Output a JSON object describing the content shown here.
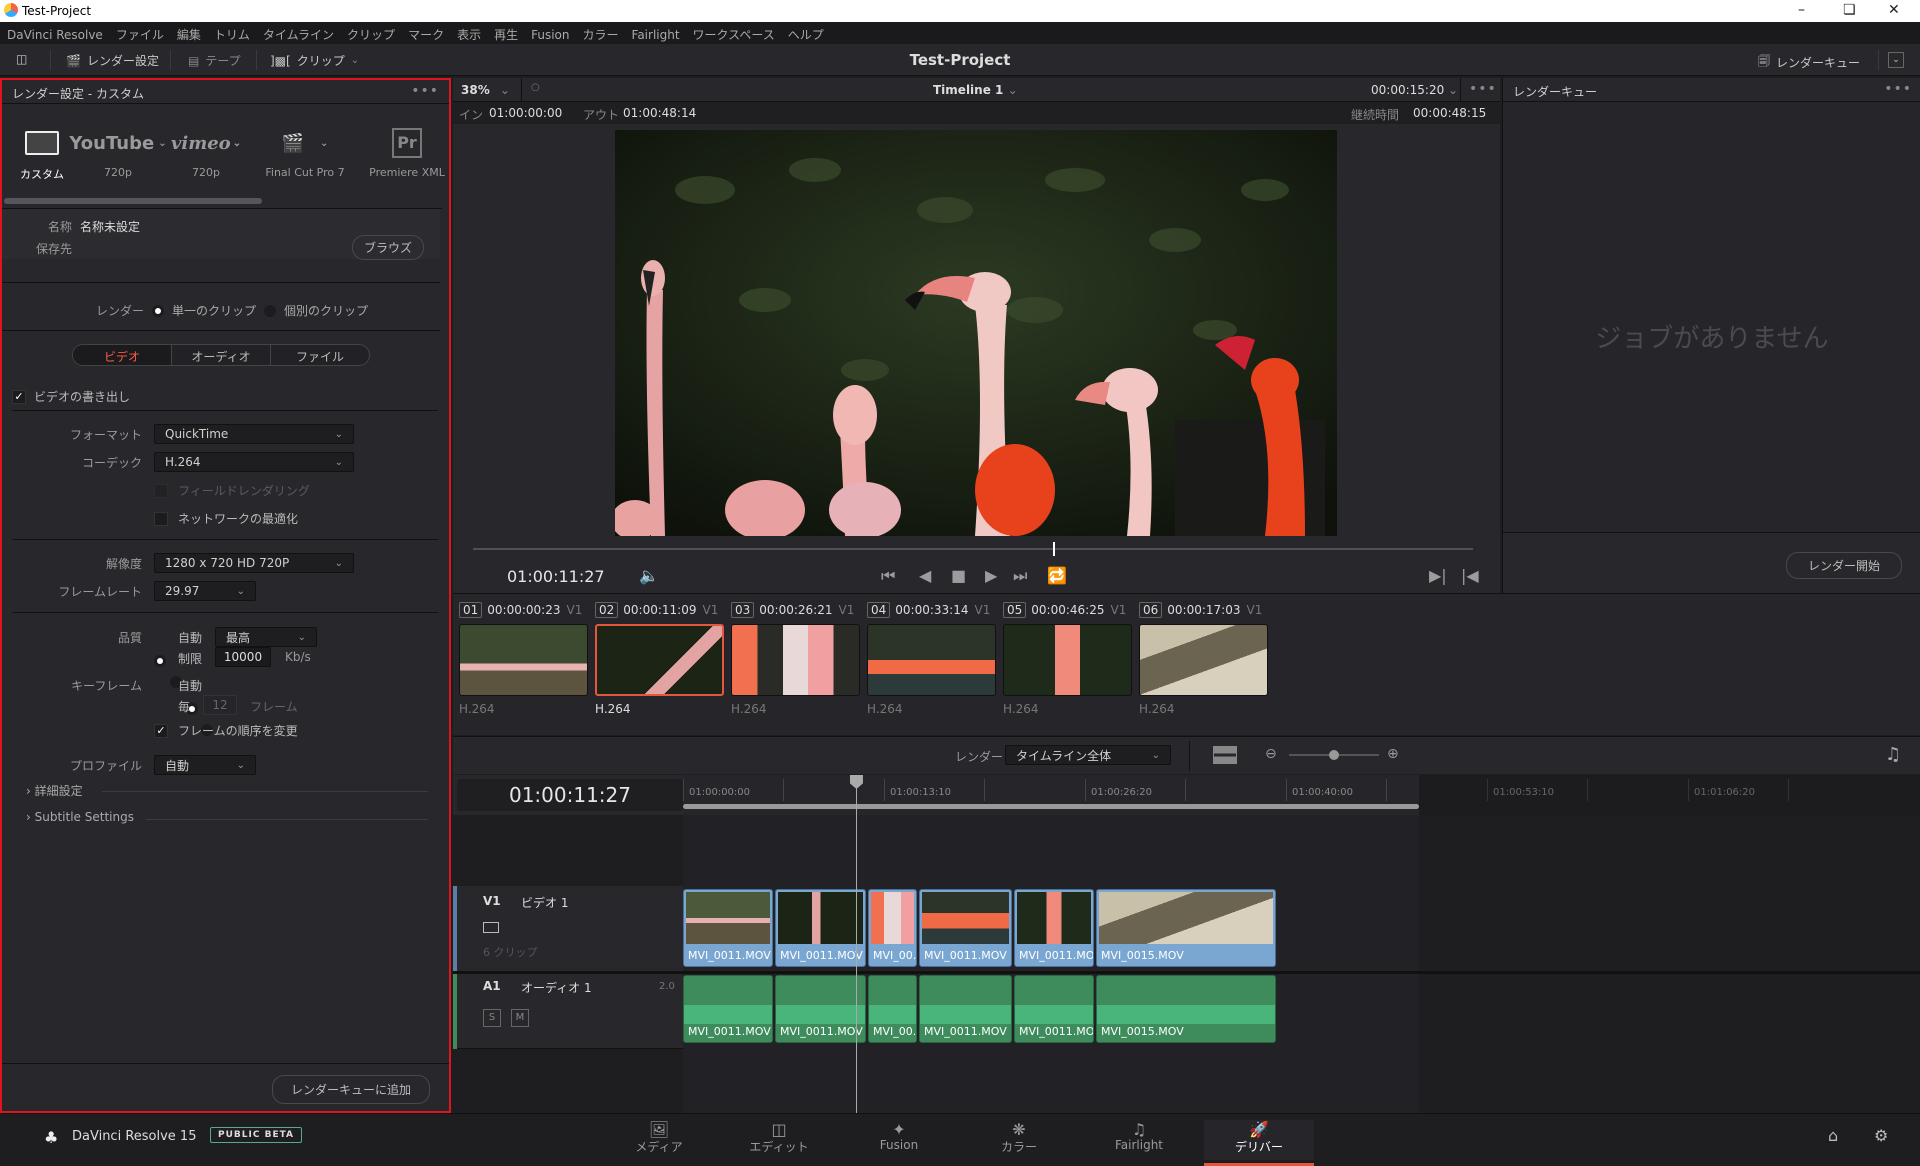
{
  "window": {
    "title": "Test-Project",
    "controls": [
      "minimize",
      "restore",
      "close"
    ]
  },
  "menu": [
    "DaVinci Resolve",
    "ファイル",
    "編集",
    "トリム",
    "タイムライン",
    "クリップ",
    "マーク",
    "表示",
    "再生",
    "Fusion",
    "カラー",
    "Fairlight",
    "ワークスペース",
    "ヘルプ"
  ],
  "toolbar": {
    "render_settings": "レンダー設定",
    "tape": "テープ",
    "clip": "クリップ",
    "project_title": "Test-Project",
    "render_queue": "レンダーキュー"
  },
  "render_settings": {
    "header": "レンダー設定 - カスタム",
    "presets": [
      {
        "icon": "film-icon",
        "label": "カスタム",
        "active": true
      },
      {
        "icon": "youtube-logo",
        "logo": "YouTube",
        "label": "720p"
      },
      {
        "icon": "vimeo-logo",
        "logo": "vimeo",
        "label": "720p"
      },
      {
        "icon": "clapper-icon",
        "label": "Final Cut Pro 7"
      },
      {
        "icon": "premiere-icon",
        "logo": "Pr",
        "label": "Premiere XML"
      }
    ],
    "name_label": "名称",
    "name_value": "名称未設定",
    "location_label": "保存先",
    "browse": "ブラウズ",
    "render_label": "レンダー",
    "render_single": "単一のクリップ",
    "render_individual": "個別のクリップ",
    "render_mode": "single",
    "tabs": [
      "ビデオ",
      "オーディオ",
      "ファイル"
    ],
    "active_tab": "ビデオ",
    "export_video": {
      "label": "ビデオの書き出し",
      "checked": true
    },
    "format_label": "フォーマット",
    "format_value": "QuickTime",
    "codec_label": "コーデック",
    "codec_value": "H.264",
    "field_rendering": {
      "label": "フィールドレンダリング",
      "checked": false,
      "disabled": true
    },
    "network_opt": {
      "label": "ネットワークの最適化",
      "checked": false
    },
    "resolution_label": "解像度",
    "resolution_value": "1280 x 720 HD 720P",
    "framerate_label": "フレームレート",
    "framerate_value": "29.97",
    "quality_label": "品質",
    "quality_auto": "自動",
    "quality_auto_value": "最高",
    "quality_limit": "制限",
    "quality_limit_value": "10000",
    "quality_unit": "Kb/s",
    "keyframe_label": "キーフレーム",
    "keyframe_auto": "自動",
    "keyframe_every": "毎",
    "keyframe_every_value": "12",
    "keyframe_unit": "フレーム",
    "reorder": {
      "label": "フレームの順序を変更",
      "checked": true
    },
    "profile_label": "プロファイル",
    "profile_value": "自動",
    "advanced": "詳細設定",
    "subtitle": "Subtitle Settings",
    "add_to_queue": "レンダーキューに追加"
  },
  "viewer": {
    "zoom": "38%",
    "timeline_name": "Timeline 1",
    "timecode_top": "00:00:15:20",
    "in_label": "イン",
    "in_value": "01:00:00:00",
    "out_label": "アウト",
    "out_value": "01:00:48:14",
    "duration_label": "継続時間",
    "duration_value": "00:00:48:15",
    "current_tc": "01:00:11:27",
    "scrub_position": 0.58
  },
  "queue": {
    "header": "レンダーキュー",
    "empty": "ジョブがありません",
    "start": "レンダー開始"
  },
  "clips": [
    {
      "num": "01",
      "tc": "00:00:00:23",
      "track": "V1",
      "codec": "H.264",
      "selected": false
    },
    {
      "num": "02",
      "tc": "00:00:11:09",
      "track": "V1",
      "codec": "H.264",
      "selected": true
    },
    {
      "num": "03",
      "tc": "00:00:26:21",
      "track": "V1",
      "codec": "H.264",
      "selected": false
    },
    {
      "num": "04",
      "tc": "00:00:33:14",
      "track": "V1",
      "codec": "H.264",
      "selected": false
    },
    {
      "num": "05",
      "tc": "00:00:46:25",
      "track": "V1",
      "codec": "H.264",
      "selected": false
    },
    {
      "num": "06",
      "tc": "00:00:17:03",
      "track": "V1",
      "codec": "H.264",
      "selected": false
    }
  ],
  "timeline": {
    "render_label": "レンダー",
    "render_range": "タイムライン全体",
    "timecode": "01:00:11:27",
    "ruler": [
      "01:00:00:00",
      "01:00:13:10",
      "01:00:26:20",
      "01:00:40:00",
      "01:00:53:10",
      "01:01:06:20"
    ],
    "zoom_level": 0.5,
    "video_track": {
      "id": "V1",
      "name": "ビデオ 1",
      "count": "6 クリップ"
    },
    "audio_track": {
      "id": "A1",
      "name": "オーディオ 1",
      "channels": "2.0",
      "solo": "S",
      "mute": "M"
    },
    "video_clips": [
      "MVI_0011.MOV",
      "MVI_0011.MOV",
      "MVI_00...",
      "MVI_0011.MOV",
      "MVI_0011.MOV",
      "MVI_0015.MOV"
    ],
    "audio_clips": [
      "MVI_0011.MOV",
      "MVI_0011.MOV",
      "MVI_00...",
      "MVI_0011.MOV",
      "MVI_0011.MOV",
      "MVI_0015.MOV"
    ]
  },
  "bottom": {
    "app_name": "DaVinci Resolve 15",
    "badge": "PUBLIC BETA",
    "pages": [
      {
        "label": "メディア",
        "icon": "media-icon"
      },
      {
        "label": "エディット",
        "icon": "edit-icon"
      },
      {
        "label": "Fusion",
        "icon": "fusion-icon"
      },
      {
        "label": "カラー",
        "icon": "color-icon"
      },
      {
        "label": "Fairlight",
        "icon": "fairlight-icon"
      },
      {
        "label": "デリバー",
        "icon": "deliver-icon",
        "active": true
      }
    ]
  },
  "colors": {
    "accent": "#e4573c",
    "selection_border": "#e0141e",
    "video_clip": "#7aa7d2",
    "audio_clip": "#3e8c5c"
  }
}
